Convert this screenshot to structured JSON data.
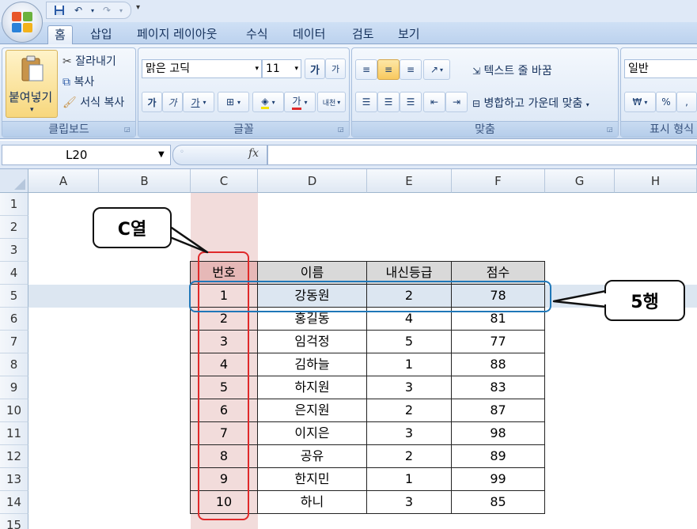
{
  "quick_access": {
    "save_icon": "save-icon",
    "undo_icon": "undo-icon",
    "redo_icon": "redo-icon",
    "more": "▾"
  },
  "tabs": [
    "홈",
    "삽입",
    "페이지 레이아웃",
    "수식",
    "데이터",
    "검토",
    "보기"
  ],
  "ribbon": {
    "clipboard": {
      "paste": "붙여넣기",
      "cut": "잘라내기",
      "copy": "복사",
      "format_painter": "서식 복사",
      "label": "클립보드"
    },
    "font": {
      "name": "맑은 고딕",
      "size": "11",
      "grow": "가",
      "shrink": "가",
      "bold": "가",
      "italic": "가",
      "underline": "가",
      "font_color": "가",
      "phonetic": "내천",
      "label": "글꼴"
    },
    "alignment": {
      "wrap_text": "텍스트 줄 바꿈",
      "merge_center": "병합하고 가운데 맞춤",
      "label": "맞춤"
    },
    "number": {
      "format": "일반",
      "currency": "₩",
      "percent": "%",
      "comma": ",",
      "label": "표시 형식"
    }
  },
  "formula_bar": {
    "name_box": "L20",
    "fx": "fx",
    "formula": ""
  },
  "sheet": {
    "columns": [
      "A",
      "B",
      "C",
      "D",
      "E",
      "F",
      "G",
      "H"
    ],
    "rows": [
      "1",
      "2",
      "3",
      "4",
      "5",
      "6",
      "7",
      "8",
      "9",
      "10",
      "11",
      "12",
      "13",
      "14",
      "15"
    ],
    "table": {
      "headers": [
        "번호",
        "이름",
        "내신등급",
        "점수"
      ],
      "rows": [
        [
          "1",
          "강동원",
          "2",
          "78"
        ],
        [
          "2",
          "홍길동",
          "4",
          "81"
        ],
        [
          "3",
          "임걱정",
          "5",
          "77"
        ],
        [
          "4",
          "김하늘",
          "1",
          "88"
        ],
        [
          "5",
          "하지원",
          "3",
          "83"
        ],
        [
          "6",
          "은지원",
          "2",
          "87"
        ],
        [
          "7",
          "이지은",
          "3",
          "98"
        ],
        [
          "8",
          "공유",
          "2",
          "89"
        ],
        [
          "9",
          "한지민",
          "1",
          "99"
        ],
        [
          "10",
          "하니",
          "3",
          "85"
        ]
      ]
    }
  },
  "annotations": {
    "column_callout": "C열",
    "row_callout": "5행"
  },
  "colors": {
    "column_highlight": "#e0292a",
    "row_highlight": "#1f77b8",
    "c_column_fill": "#f2dcdb",
    "row5_fill": "#dce6f1"
  }
}
